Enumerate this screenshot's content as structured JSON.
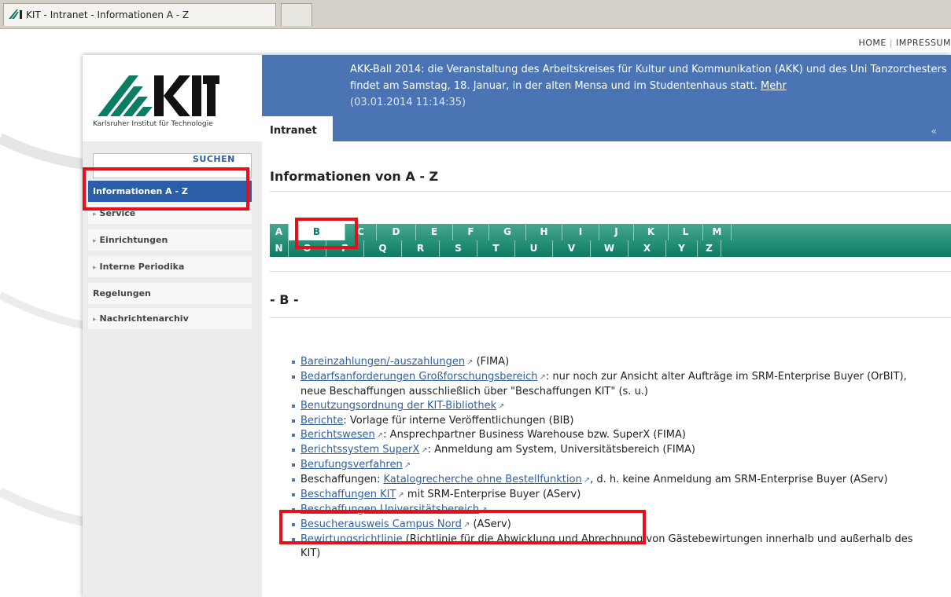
{
  "browser": {
    "tab_title": "KIT - Intranet - Informationen A - Z"
  },
  "top_links": [
    "HOME",
    "IMPRESSUM"
  ],
  "logo": {
    "text": "KIT",
    "subtitle": "Karlsruher Institut für Technologie"
  },
  "news": {
    "text": "AKK-Ball 2014: die Veranstaltung des Arbeitskreises für Kultur und Kommunikation (AKK) und des Uni Tanzorchesters findet am Samstag, 18. Januar, in der alten Mensa und im Studentenhaus statt.",
    "more": "Mehr",
    "date": "(03.01.2014 11:14:35)"
  },
  "header_tab": "Intranet",
  "header_chevron": "«",
  "search": {
    "button": "SUCHEN"
  },
  "nav": [
    {
      "label": "Informationen A - Z",
      "active": true
    },
    {
      "label": "Service"
    },
    {
      "label": "Einrichtungen"
    },
    {
      "label": "Interne Periodika"
    },
    {
      "label": "Regelungen"
    },
    {
      "label": "Nachrichtenarchiv"
    }
  ],
  "page_title": "Informationen von A - Z",
  "alphabet": {
    "row1": [
      "A",
      "B",
      "C",
      "D",
      "E",
      "F",
      "G",
      "H",
      "I",
      "J",
      "K",
      "L",
      "M"
    ],
    "row2": [
      "N",
      "O",
      "P",
      "Q",
      "R",
      "S",
      "T",
      "U",
      "V",
      "W",
      "X",
      "Y",
      "Z"
    ],
    "selected": "B"
  },
  "section_heading": "- B -",
  "entries": [
    {
      "link": "Bareinzahlungen/-auszahlungen",
      "ext": true,
      "rest": " (FIMA)"
    },
    {
      "link": "Bedarfsanforderungen Großforschungsbereich",
      "ext": true,
      "rest": ": nur noch zur Ansicht alter Aufträge im SRM-Enterprise Buyer (OrBIT), neue Beschaffungen ausschließlich über \"Beschaffungen KIT\" (s. u.)"
    },
    {
      "link": "Benutzungsordnung der KIT-Bibliothek",
      "ext": true,
      "rest": ""
    },
    {
      "link": "Berichte",
      "ext": false,
      "rest": ": Vorlage für interne Veröffentlichungen (BIB)"
    },
    {
      "link": "Berichtswesen",
      "ext": true,
      "rest": ": Ansprechpartner Business Warehouse bzw. SuperX (FIMA)"
    },
    {
      "link": "Berichtssystem SuperX",
      "ext": true,
      "rest": ": Anmeldung am System, Universitätsbereich (FIMA)"
    },
    {
      "link": "Berufungsverfahren",
      "ext": true,
      "rest": ""
    },
    {
      "pre": "Beschaffungen: ",
      "link": "Katalogrecherche ohne Bestellfunktion",
      "ext": true,
      "rest": ", d. h. keine Anmeldung am SRM-Enterprise Buyer (AServ)"
    },
    {
      "link": "Beschaffungen KIT",
      "ext": true,
      "rest": " mit SRM-Enterprise Buyer (AServ)"
    },
    {
      "link": "Beschaffungen Universitätsbereich",
      "ext": true,
      "rest": ""
    },
    {
      "link": "Besucherausweis Campus Nord",
      "ext": true,
      "rest": " (AServ)"
    },
    {
      "link": "Bewirtungsrichtlinie",
      "ext": false,
      "rest": " (Richtlinie für die Abwicklung und Abrechnung von Gästebewirtungen innerhalb und außerhalb des KIT)"
    }
  ],
  "colors": {
    "header_blue": "#4a74b3",
    "nav_active": "#2b5ea6",
    "abc_green": "#0c7c63",
    "highlight_red": "#e5101a"
  }
}
